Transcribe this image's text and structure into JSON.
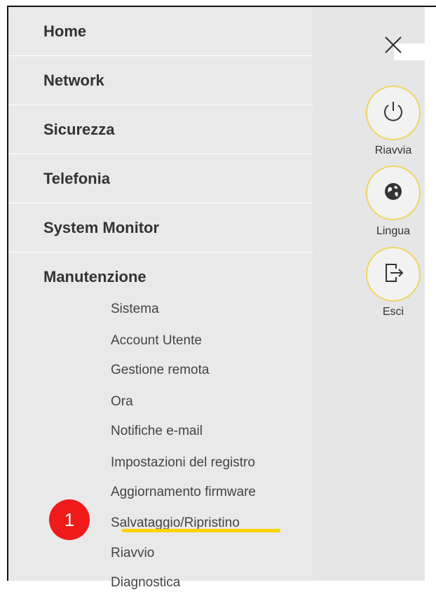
{
  "menu": {
    "main_items": [
      "Home",
      "Network",
      "Sicurezza",
      "Telefonia",
      "System Monitor",
      "Manutenzione"
    ],
    "sub_items": [
      "Sistema",
      "Account Utente",
      "Gestione remota",
      "Ora",
      "Notifiche e-mail",
      "Impostazioni del registro",
      "Aggiornamento firmware",
      "Salvataggio/Ripristino",
      "Riavvio",
      "Diagnostica"
    ]
  },
  "side_actions": {
    "restart_label": "Riavvia",
    "language_label": "Lingua",
    "logout_label": "Esci"
  },
  "annotation": {
    "badge_number": "1"
  },
  "icons": {
    "close": "close-icon",
    "power": "power-icon",
    "globe": "globe-icon",
    "logout": "logout-icon"
  },
  "colors": {
    "menu_bg": "#e9e9e9",
    "accent_ring": "#f0d461",
    "badge": "#ef1a1a",
    "highlight": "#ffd400"
  }
}
